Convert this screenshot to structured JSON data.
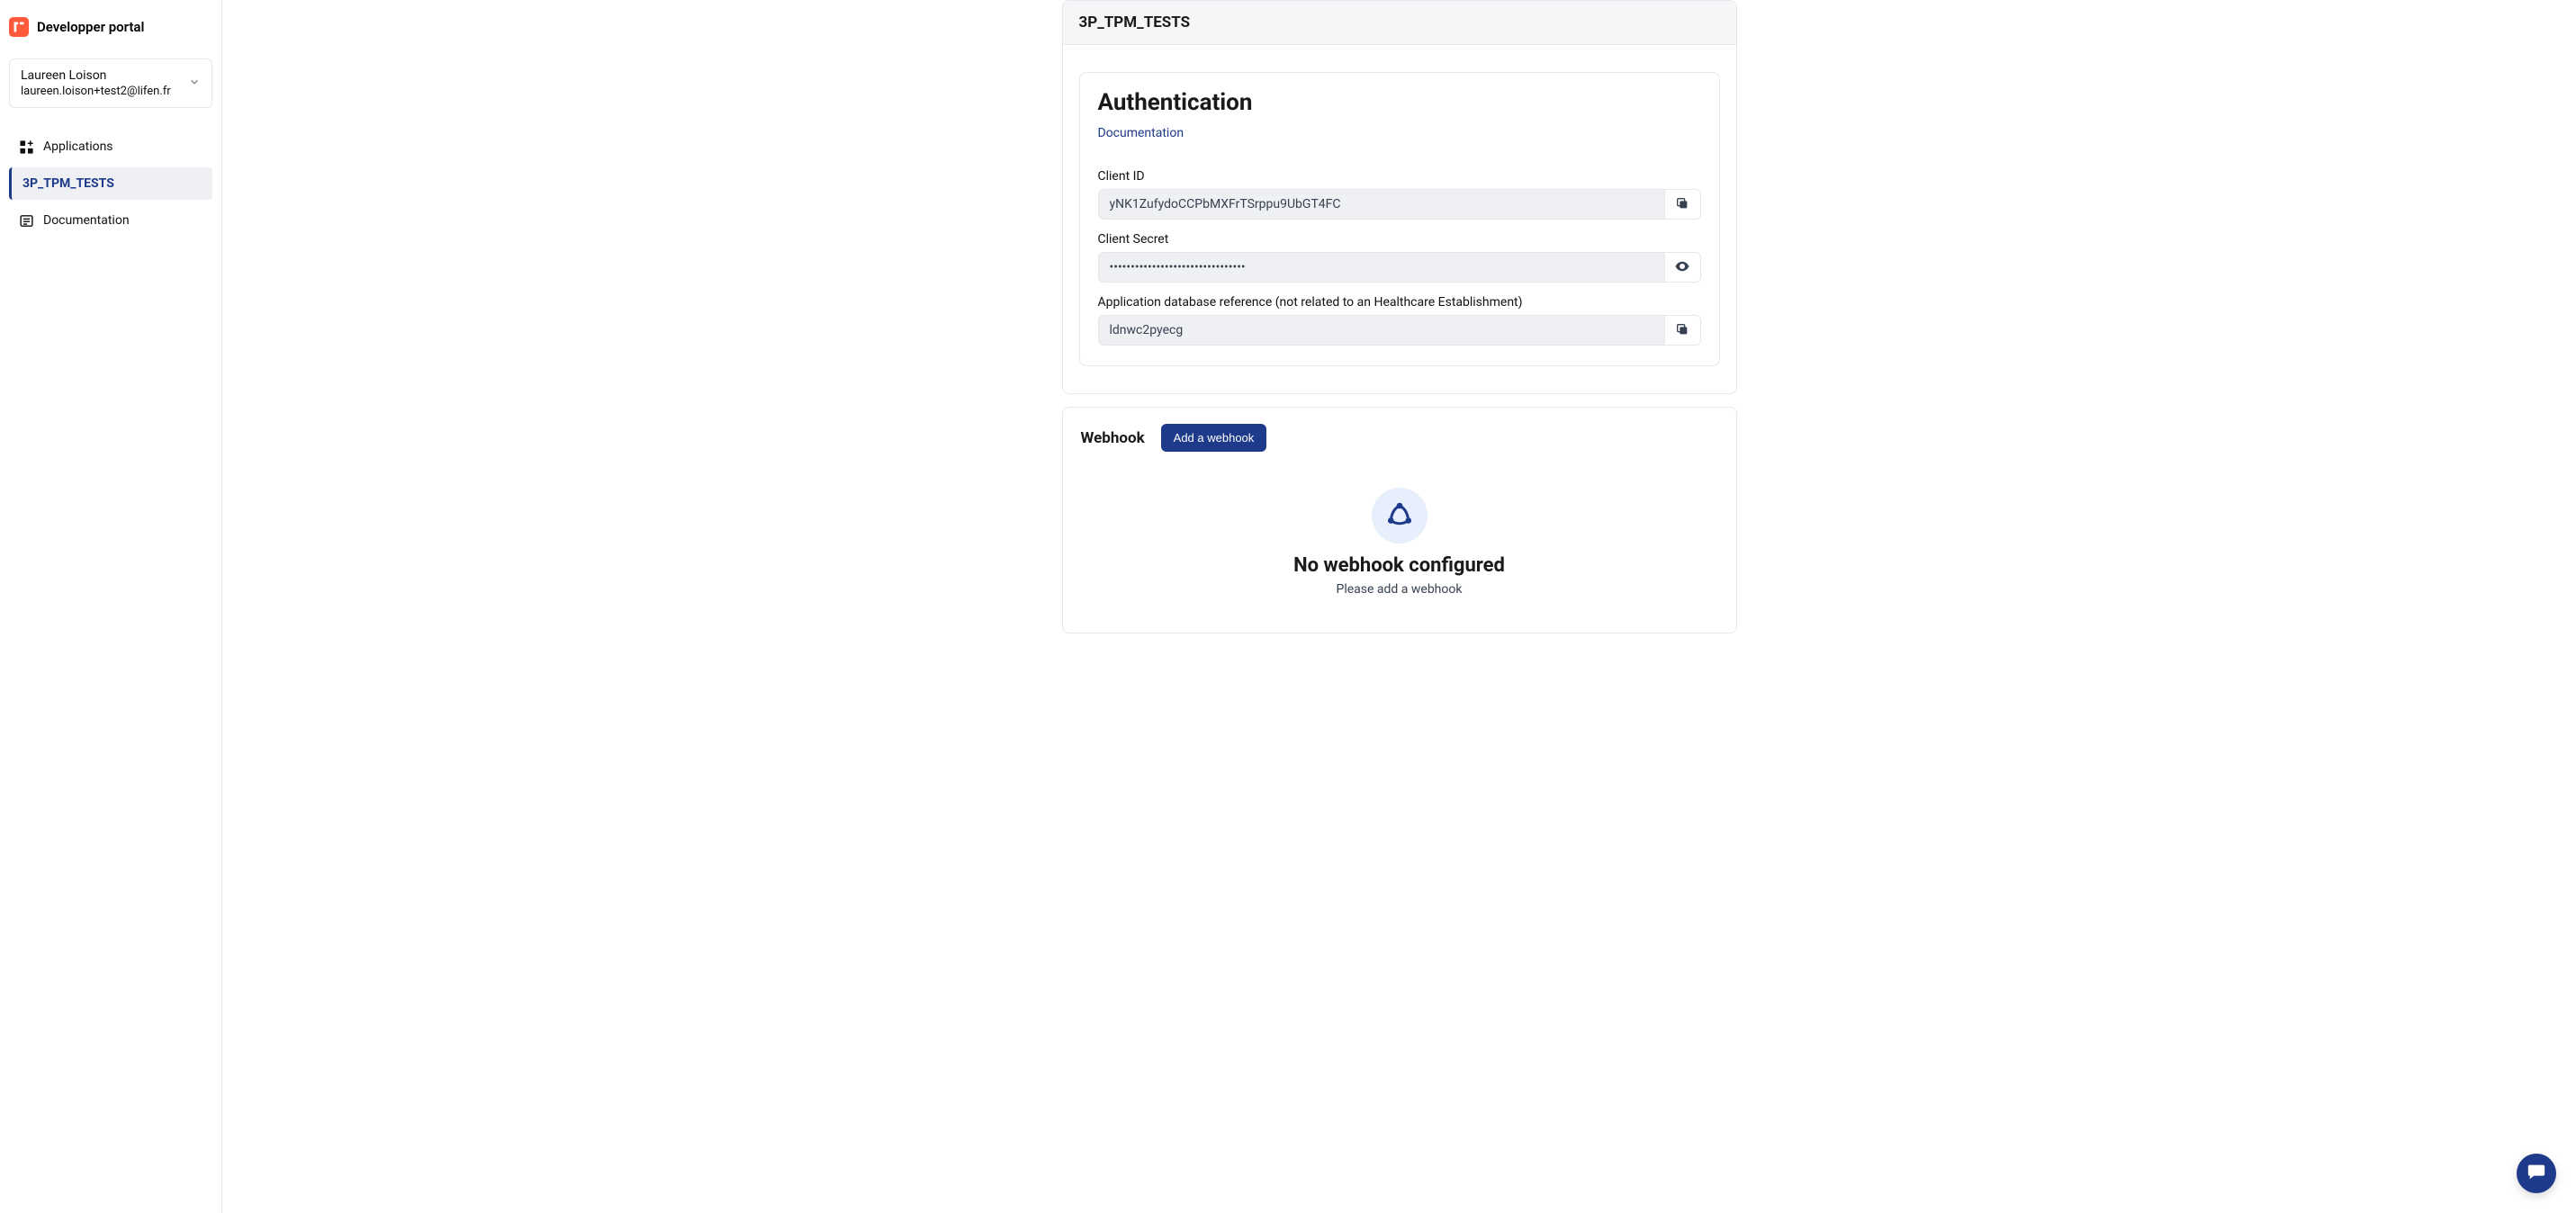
{
  "brand": {
    "title": "Developper portal"
  },
  "user": {
    "name": "Laureen Loison",
    "email": "laureen.loison+test2@lifen.fr"
  },
  "sidebar": {
    "applications_label": "Applications",
    "active_app": "3P_TPM_TESTS",
    "documentation_label": "Documentation"
  },
  "header": {
    "title": "3P_TPM_TESTS"
  },
  "auth": {
    "title": "Authentication",
    "doc_link": "Documentation",
    "client_id_label": "Client ID",
    "client_id_value": "yNK1ZufydoCCPbMXFrTSrppu9UbGT4FC",
    "client_secret_label": "Client Secret",
    "client_secret_value": "••••••••••••••••••••••••••••••••",
    "db_ref_label": "Application database reference (not related to an Healthcare Establishment)",
    "db_ref_value": "ldnwc2pyecg"
  },
  "webhook": {
    "title": "Webhook",
    "add_button": "Add a webhook",
    "empty_title": "No webhook configured",
    "empty_sub": "Please add a webhook"
  }
}
